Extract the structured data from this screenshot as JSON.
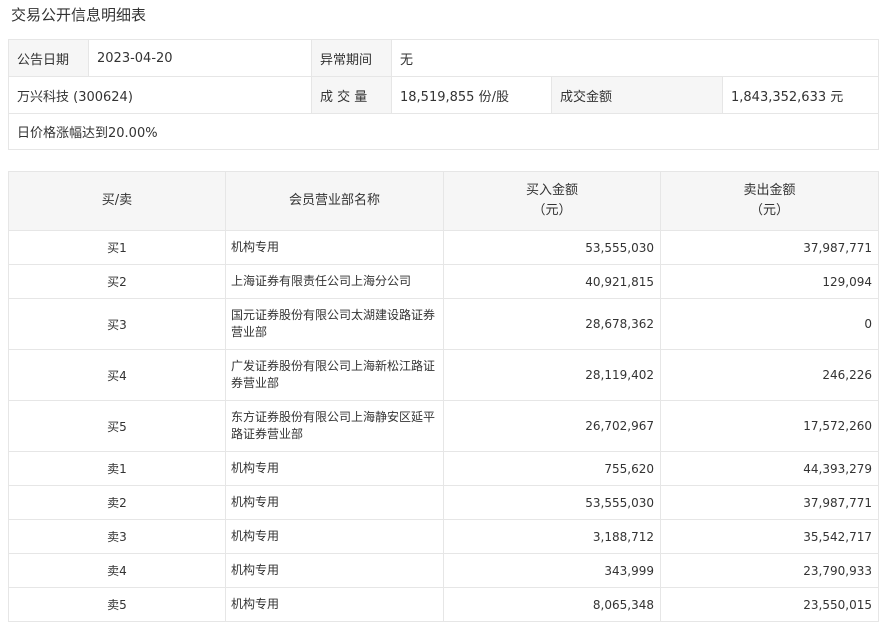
{
  "title": "交易公开信息明细表",
  "info": {
    "date_label": "公告日期",
    "date_value": "2023-04-20",
    "period_label": "异常期间",
    "period_value": "无",
    "stock_name": "万兴科技 (300624)",
    "volume_label": "成 交 量",
    "volume_value": "18,519,855 份/股",
    "amount_label": "成交金额",
    "amount_value": "1,843,352,633 元",
    "reason": "日价格涨幅达到20.00%"
  },
  "table": {
    "headers": {
      "side": "买/卖",
      "name": "会员营业部名称",
      "buy_line1": "买入金额",
      "buy_line2": "（元）",
      "sell_line1": "卖出金额",
      "sell_line2": "（元）"
    },
    "rows": [
      {
        "side": "买1",
        "name": "机构专用",
        "buy": "53,555,030",
        "sell": "37,987,771"
      },
      {
        "side": "买2",
        "name": "上海证券有限责任公司上海分公司",
        "buy": "40,921,815",
        "sell": "129,094"
      },
      {
        "side": "买3",
        "name": "国元证券股份有限公司太湖建设路证券营业部",
        "buy": "28,678,362",
        "sell": "0"
      },
      {
        "side": "买4",
        "name": "广发证券股份有限公司上海新松江路证券营业部",
        "buy": "28,119,402",
        "sell": "246,226"
      },
      {
        "side": "买5",
        "name": "东方证券股份有限公司上海静安区延平路证券营业部",
        "buy": "26,702,967",
        "sell": "17,572,260"
      },
      {
        "side": "卖1",
        "name": "机构专用",
        "buy": "755,620",
        "sell": "44,393,279"
      },
      {
        "side": "卖2",
        "name": "机构专用",
        "buy": "53,555,030",
        "sell": "37,987,771"
      },
      {
        "side": "卖3",
        "name": "机构专用",
        "buy": "3,188,712",
        "sell": "35,542,717"
      },
      {
        "side": "卖4",
        "name": "机构专用",
        "buy": "343,999",
        "sell": "23,790,933"
      },
      {
        "side": "卖5",
        "name": "机构专用",
        "buy": "8,065,348",
        "sell": "23,550,015"
      }
    ]
  }
}
